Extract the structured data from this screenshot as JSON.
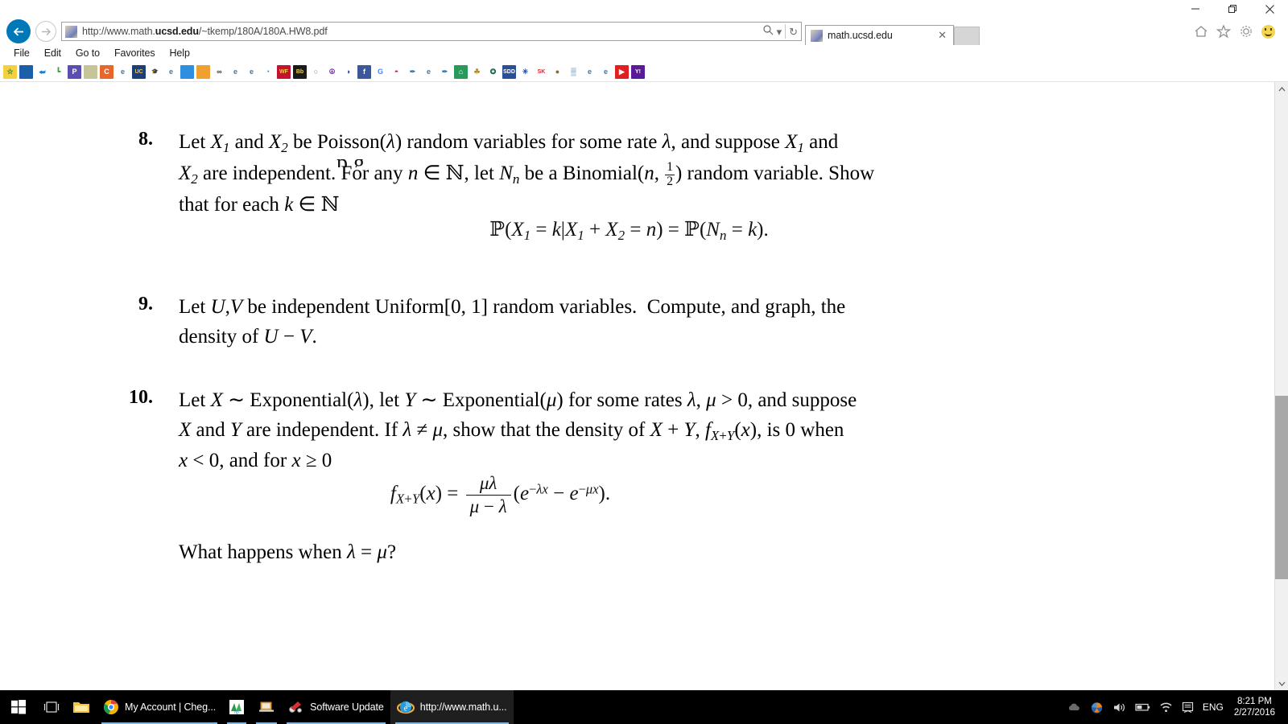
{
  "window": {
    "minimize_label": "—",
    "restore_label": "❐",
    "close_label": "✕"
  },
  "nav": {
    "back_label": "←",
    "forward_label": "→",
    "url_prefix": "http://www.math.",
    "url_bold": "ucsd.edu",
    "url_suffix": "/~tkemp/180A/180A.HW8.pdf",
    "search_icon": "search-icon",
    "search_dropdown": "▾",
    "refresh_icon": "↻",
    "home_icon": "home-icon",
    "favorites_icon": "star-icon",
    "settings_icon": "gear-icon",
    "feedback_icon": "smiley-icon"
  },
  "tabs": [
    {
      "label": "math.ucsd.edu",
      "close_label": "✕"
    }
  ],
  "menu": {
    "items": [
      "File",
      "Edit",
      "Go to",
      "Favorites",
      "Help"
    ]
  },
  "favorites": {
    "items": [
      {
        "name": "add-to-favorites",
        "glyph": "☆",
        "bg": "#f4d03f",
        "fg": "#2a7a2a"
      },
      {
        "name": "bookmark-blue-circle",
        "glyph": "",
        "bg": "#1b5fa8",
        "fg": "#ffffff"
      },
      {
        "name": "bookmark-fish",
        "glyph": "⮨",
        "bg": "#ffffff",
        "fg": "#1b7fd0"
      },
      {
        "name": "bookmark-green-chart",
        "glyph": "┗",
        "bg": "#ffffff",
        "fg": "#3fa03f"
      },
      {
        "name": "bookmark-p-purple",
        "glyph": "P",
        "bg": "#5a4fb0",
        "fg": "#ffffff"
      },
      {
        "name": "bookmark-map",
        "glyph": "",
        "bg": "#c8c49a",
        "fg": "#6f7fb0"
      },
      {
        "name": "bookmark-c-orange",
        "glyph": "C",
        "bg": "#e8662a",
        "fg": "#ffffff"
      },
      {
        "name": "bookmark-ie-page",
        "glyph": "e",
        "bg": "#ffffff",
        "fg": "#1b7fd0"
      },
      {
        "name": "bookmark-uc",
        "glyph": "UC",
        "bg": "#1b3f7a",
        "fg": "#f4c43f"
      },
      {
        "name": "bookmark-graduation-cap",
        "glyph": "🎓",
        "bg": "#ffffff",
        "fg": "#111111"
      },
      {
        "name": "bookmark-ie-page-2",
        "glyph": "e",
        "bg": "#ffffff",
        "fg": "#1b7fd0"
      },
      {
        "name": "bookmark-blue-square",
        "glyph": "",
        "bg": "#2e8fe0",
        "fg": "#ffffff"
      },
      {
        "name": "bookmark-gift-bag",
        "glyph": "",
        "bg": "#f0a030",
        "fg": "#ffffff"
      },
      {
        "name": "bookmark-bb-link",
        "glyph": "∞",
        "bg": "#ffffff",
        "fg": "#333333"
      },
      {
        "name": "bookmark-ie-page-3",
        "glyph": "e",
        "bg": "#ffffff",
        "fg": "#1b7fd0"
      },
      {
        "name": "bookmark-ie-page-4",
        "glyph": "e",
        "bg": "#ffffff",
        "fg": "#1b7fd0"
      },
      {
        "name": "bookmark-globe",
        "glyph": "◔",
        "bg": "#ffffff",
        "fg": "#2a7fc0"
      },
      {
        "name": "bookmark-wf-red",
        "glyph": "WF",
        "bg": "#c41230",
        "fg": "#f4d03f"
      },
      {
        "name": "bookmark-bb-blackboard",
        "glyph": "Bb",
        "bg": "#1a1a1a",
        "fg": "#f4d03f"
      },
      {
        "name": "bookmark-chat-bubble",
        "glyph": "○",
        "bg": "#ffffff",
        "fg": "#3fa03f"
      },
      {
        "name": "bookmark-peace-purple",
        "glyph": "☮",
        "bg": "#ffffff",
        "fg": "#7a3fa0"
      },
      {
        "name": "bookmark-car",
        "glyph": "◑",
        "bg": "#ffffff",
        "fg": "#1b3f9a"
      },
      {
        "name": "bookmark-facebook",
        "glyph": "f",
        "bg": "#3b5998",
        "fg": "#ffffff"
      },
      {
        "name": "bookmark-google",
        "glyph": "G",
        "bg": "#ffffff",
        "fg": "#4285f4"
      },
      {
        "name": "bookmark-red-bell",
        "glyph": "◓",
        "bg": "#ffffff",
        "fg": "#c41230"
      },
      {
        "name": "bookmark-feather-blue",
        "glyph": "✒",
        "bg": "#ffffff",
        "fg": "#2a7fc0"
      },
      {
        "name": "bookmark-ie-page-5",
        "glyph": "e",
        "bg": "#ffffff",
        "fg": "#1b7fd0"
      },
      {
        "name": "bookmark-feather-blue-2",
        "glyph": "✒",
        "bg": "#ffffff",
        "fg": "#2a7fc0"
      },
      {
        "name": "bookmark-green-house",
        "glyph": "⌂",
        "bg": "#2a9a5a",
        "fg": "#ffffff"
      },
      {
        "name": "bookmark-tree-gold",
        "glyph": "☘",
        "bg": "#ffffff",
        "fg": "#b08a2a"
      },
      {
        "name": "bookmark-starbucks",
        "glyph": "✪",
        "bg": "#ffffff",
        "fg": "#1a6b4a"
      },
      {
        "name": "bookmark-sdd-blue",
        "glyph": "SDD",
        "bg": "#2a4f9a",
        "fg": "#ffffff"
      },
      {
        "name": "bookmark-shield-badge",
        "glyph": "✳",
        "bg": "#ffffff",
        "fg": "#2a4f9a"
      },
      {
        "name": "bookmark-sk-red",
        "glyph": "SK",
        "bg": "#ffffff",
        "fg": "#e8222a"
      },
      {
        "name": "bookmark-seal-brown",
        "glyph": "●",
        "bg": "#ffffff",
        "fg": "#8a6a2a"
      },
      {
        "name": "bookmark-grid-blue",
        "glyph": "▒",
        "bg": "#ffffff",
        "fg": "#2a5fa0"
      },
      {
        "name": "bookmark-ie-page-6",
        "glyph": "e",
        "bg": "#ffffff",
        "fg": "#1b7fd0"
      },
      {
        "name": "bookmark-ie-page-7",
        "glyph": "e",
        "bg": "#ffffff",
        "fg": "#1b7fd0"
      },
      {
        "name": "bookmark-youtube",
        "glyph": "▶",
        "bg": "#e02020",
        "fg": "#ffffff"
      },
      {
        "name": "bookmark-yahoo",
        "glyph": "Y!",
        "bg": "#5a1a9a",
        "fg": "#ffffff"
      }
    ]
  },
  "document": {
    "cut_line_top": "p g",
    "problems": [
      {
        "number": "8.",
        "lines": [
          "Let X₁ and X₂ be Poisson(λ) random variables for some rate λ, and suppose X₁ and",
          "X₂ are independent. For any n ∈ ℕ, let Nₙ be a Binomial(n, 1/2) random variable. Show",
          "that for each k ∈ ℕ"
        ],
        "equation": "ℙ(X₁ = k|X₁ + X₂ = n) = ℙ(Nₙ = k)."
      },
      {
        "number": "9.",
        "lines": [
          "Let U, V be independent Uniform[0, 1] random variables.  Compute, and graph, the",
          "density of U − V."
        ],
        "equation": ""
      },
      {
        "number": "10.",
        "lines": [
          "Let X ∼ Exponential(λ), let Y ∼ Exponential(μ) for some rates λ, μ > 0, and suppose",
          "X and Y are independent. If λ ≠ μ, show that the density of X + Y, fₓ₊ᵧ(x), is 0 when",
          "x < 0, and for x ≥ 0"
        ],
        "equation": "f_{X+Y}(x) = μλ/(μ − λ)(e^{−λx} − e^{−μx}).",
        "closing": "What happens when λ = μ?"
      }
    ]
  },
  "scrollbar": {
    "up_arrow": "▲",
    "down_arrow": "▼"
  },
  "taskbar": {
    "start_label": "start-button",
    "taskview_label": "task-view",
    "buttons": [
      {
        "name": "file-explorer",
        "label": "",
        "icon": "folder-icon"
      },
      {
        "name": "chrome-window",
        "label": "My Account | Cheg...",
        "icon": "chrome-icon"
      },
      {
        "name": "hp-window",
        "label": "",
        "icon": "hp-icon"
      },
      {
        "name": "laptop-window",
        "label": "",
        "icon": "laptop-icon"
      },
      {
        "name": "software-update-window",
        "label": "Software Update",
        "icon": "software-update-icon"
      },
      {
        "name": "ie-window",
        "label": "http://www.math.u...",
        "icon": "ie-icon"
      }
    ],
    "tray": {
      "show_hidden": "▲",
      "icons": [
        "cloud-icon",
        "firefox-icon",
        "volume-icon",
        "battery-icon",
        "wifi-icon",
        "action-center-icon"
      ],
      "language": "ENG",
      "time": "8:21 PM",
      "date": "2/27/2016"
    }
  }
}
